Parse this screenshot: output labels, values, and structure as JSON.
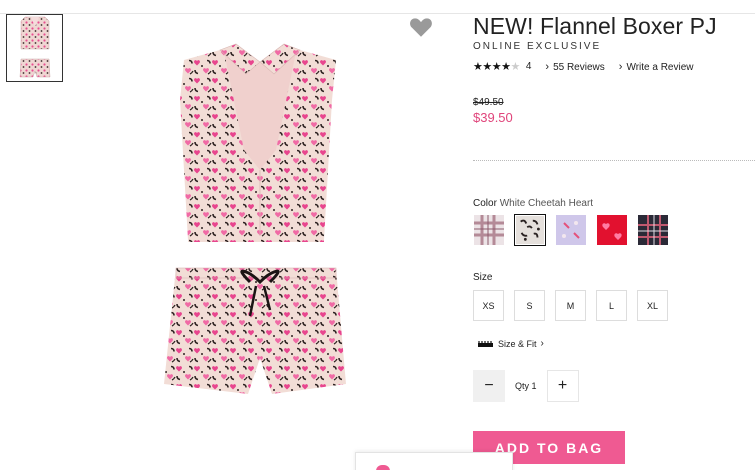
{
  "product": {
    "title": "NEW! Flannel Boxer PJ",
    "tag": "ONLINE EXCLUSIVE",
    "rating_stars": 4,
    "rating_max": 5,
    "rating_count": "4",
    "reviews_link": "55 Reviews",
    "write_review_link": "Write a Review",
    "original_price": "$49.50",
    "sale_price": "$39.50"
  },
  "color": {
    "label": "Color",
    "selected_name": "White Cheetah Heart",
    "swatches": [
      {
        "name": "plaid-lavender-swatch",
        "color": "#d9c3cc"
      },
      {
        "name": "white-cheetah-heart-swatch",
        "color": "#b9a7a2",
        "selected": true
      },
      {
        "name": "lavender-print-swatch",
        "color": "#c9c1e4"
      },
      {
        "name": "red-heart-swatch",
        "color": "#e01b3a"
      },
      {
        "name": "navy-plaid-swatch",
        "color": "#2b2b3a"
      }
    ]
  },
  "size": {
    "label": "Size",
    "options": [
      "XS",
      "S",
      "M",
      "L",
      "XL"
    ]
  },
  "size_fit": {
    "label": "Size & Fit"
  },
  "quantity": {
    "label": "Qty",
    "value": "1",
    "minus": "−",
    "plus": "+"
  },
  "cta": {
    "add_to_bag": "ADD TO BAG"
  },
  "colors": {
    "accent_pink": "#ef5a92",
    "sale_price": "#e0457b"
  },
  "icons": {
    "favorite": "heart-icon",
    "size_fit": "ruler-icon"
  }
}
